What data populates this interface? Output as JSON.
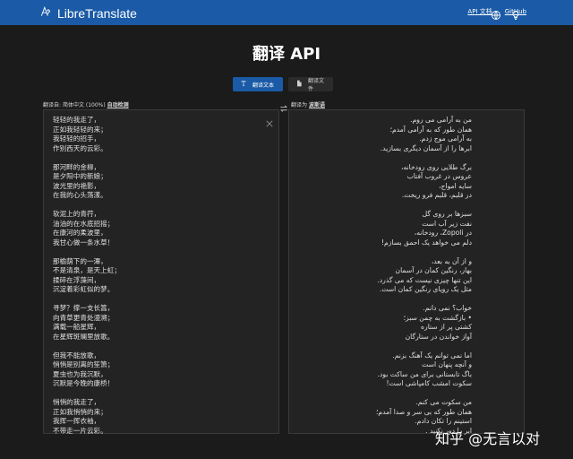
{
  "header": {
    "brand": "LibreTranslate",
    "nav": [
      {
        "label": "API 文档"
      },
      {
        "label": "GitHub"
      }
    ]
  },
  "page": {
    "title": "翻译 API"
  },
  "modes": {
    "text_label": "翻译文本",
    "files_label": "翻译文件",
    "active": "text"
  },
  "source": {
    "prefix": "翻译自",
    "detected": "简体中文 (100%)",
    "selected": "自动检测",
    "text": "轻轻的我走了，\n正如我轻轻的来；\n我轻轻的招手，\n作别西天的云彩。\n\n那河畔的金柳，\n是夕阳中的新娘；\n波光里的艳影，\n在我的心头荡漾。\n\n软泥上的青荇，\n油油的在水底招摇；\n在康河的柔波里，\n我甘心做一条水草！\n\n那榆荫下的一潭，\n不是清泉，是天上虹；\n揉碎在浮藻间，\n沉淀着彩虹似的梦。\n\n寻梦？撑一支长篙，\n向青草更青处漫溯；\n满载一船星辉，\n在星辉斑斓里放歌。\n\n但我不能放歌，\n悄悄是别离的笙箫；\n夏虫也为我沉默，\n沉默是今晚的康桥！\n\n悄悄的我走了，\n正如我悄悄的来；\n我挥一挥衣袖，\n不带走一片云彩。"
  },
  "target": {
    "prefix": "翻译为",
    "selected": "波斯语",
    "text": "من به آرامی می روم.\nهمان طور که به آرامی آمدم؛\nبه آرامی موج زدم.\nابرها را از آسمان دیگری بسازید.\n\nبرگ طلایی روی رودخانه،\nعروس در غروب آفتاب\nسایه امواج،\nدر قلبم، قلبم فرو ریخت.\n\nسبزها بر روی گل\nنفت زیر آب است\nدر Zopoli، رودخانه،\nدلم می خواهد یک احمق بسازم!\n\nو از آن به بعد،\nبهار، رنگین کمان در آسمان\nاین تنها چیزی نیست که می گذرد.\nمثل یک رویای رنگین کمان است.\n\nخواب؟ نمی دانم.\n• بازگشت به چمن سبز؛\nکشتی پر از ستاره\nآواز خواندن در ستارگان\n\nاما نمی توانم یک آهنگ بزنم.\nو آنچه پنهان است\nباگ تابستانی برای من ساکت بود.\nسکوت امشب کامپاشی است!\n\nمن سکوت می کنم.\nهمان طور که بی سر و صدا آمدم؛\nاستینم را تکان دادم.\nابر را دور نکنید ."
  },
  "watermark": "知乎 @无言以对",
  "colors": {
    "header_bg": "#1a5aa6",
    "page_bg": "#1b1b1b",
    "panel_bg": "#232323",
    "accent": "#1a5aa6"
  },
  "icons": [
    "logo-icon",
    "globe-icon",
    "lightbulb-icon",
    "text-icon",
    "file-icon",
    "swap-icon",
    "close-icon"
  ]
}
